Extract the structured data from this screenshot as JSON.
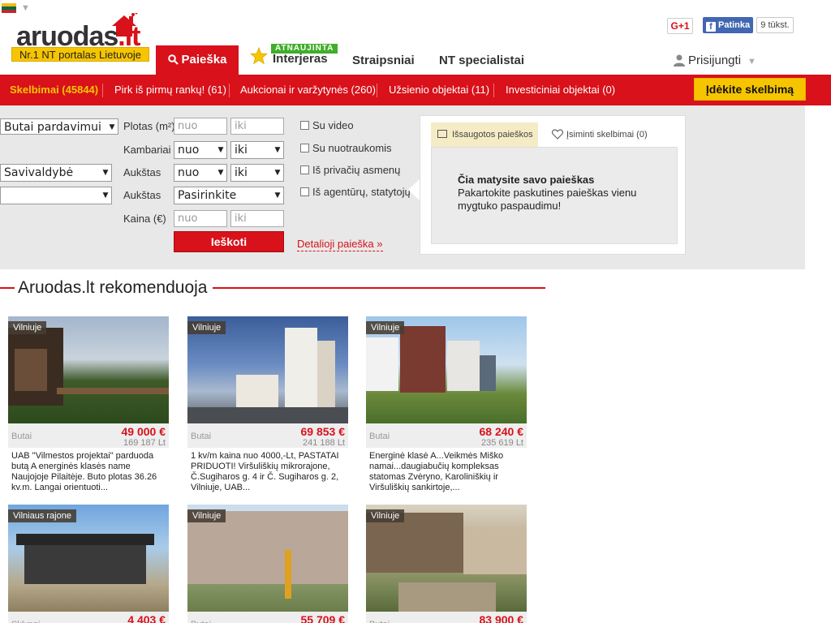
{
  "header": {
    "logo_text": "aruodas",
    "logo_suffix": ".lt",
    "tagline": "Nr.1 NT portalas Lietuvoje",
    "nav": {
      "search": "Paieška",
      "interior_badge": "ATNAUJINTA",
      "interior": "Interjeras",
      "articles": "Straipsniai",
      "specialists": "NT specialistai",
      "login": "Prisijungti"
    },
    "social": {
      "gplus": "G+1",
      "fb_like": "Patinka",
      "fb_count": "9 tūkst."
    },
    "language_flag": [
      "#fdb913",
      "#006a44",
      "#c1272d"
    ]
  },
  "redbar": {
    "ads": "Skelbimai (45844)",
    "first_hand": "Pirk iš pirmų rankų! (61)",
    "auctions": "Aukcionai ir varžytynės (260)",
    "foreign": "Užsienio objektai (11)",
    "investment": "Investiciniai objektai (0)",
    "place_ad": "Įdėkite skelbimą"
  },
  "search": {
    "type_select": "Butai pardavimui",
    "municipality_select": "Savivaldybė",
    "third_select": "",
    "labels": {
      "area": "Plotas (m²)",
      "rooms": "Kambariai",
      "floor": "Aukštas",
      "floors": "Aukštas",
      "price": "Kaina (€)"
    },
    "from_placeholder": "nuo",
    "to_placeholder": "iki",
    "floors_select": "Pasirinkite",
    "checkboxes": {
      "video": "Su video",
      "photos": "Su nuotraukomis",
      "private": "Iš privačių asmenų",
      "agencies": "Iš agentūrų, statytojų"
    },
    "search_button": "Ieškoti",
    "detailed_search": "Detalioji paieška »"
  },
  "saved": {
    "tab_searches": "Išsaugotos paieškos",
    "tab_remembered": "Įsiminti skelbimai (0)",
    "title": "Čia matysite savo paieškas",
    "text": "Pakartokite paskutines paieškas vienu mygtuko paspaudimu!"
  },
  "recommend": {
    "title": "Aruodas.lt rekomenduoja",
    "cards": [
      {
        "location": "Vilniuje",
        "type": "Butai",
        "price": "49 000 €",
        "price_lt": "169 187 Lt",
        "desc": "UAB \"Vilmestos projektai\" parduoda butą A energinės klasės name Naujojoje Pilaitėje. Buto plotas 36.26 kv.m. Langai orientuoti..."
      },
      {
        "location": "Vilniuje",
        "type": "Butai",
        "price": "69 853 €",
        "price_lt": "241 188 Lt",
        "desc": "1 kv/m kaina nuo 4000,-Lt, PASTATAI PRIDUOTI! Viršuliškių mikrorajone, Č.Sugiharos g. 4 ir Č. Sugiharos g. 2, Vilniuje, UAB..."
      },
      {
        "location": "Vilniuje",
        "type": "Butai",
        "price": "68 240 €",
        "price_lt": "235 619 Lt",
        "desc": "Energinė klasė A...Veikmės Miško namai...daugiabučių kompleksas statomas Zvėryno, Karoliniškių ir Viršuliškių sankirtoje,..."
      },
      {
        "location": "Vilniaus rajone",
        "type": "Sklypai",
        "price": "4 403 €",
        "price_lt": "",
        "desc": ""
      },
      {
        "location": "Vilniuje",
        "type": "Butai",
        "price": "55 709 €",
        "price_lt": "",
        "desc": ""
      },
      {
        "location": "Vilniuje",
        "type": "Butai",
        "price": "83 900 €",
        "price_lt": "",
        "desc": ""
      }
    ]
  },
  "colors": {
    "brand_red": "#d8111a",
    "brand_yellow": "#f6c500",
    "badge_green": "#3fae2a"
  }
}
